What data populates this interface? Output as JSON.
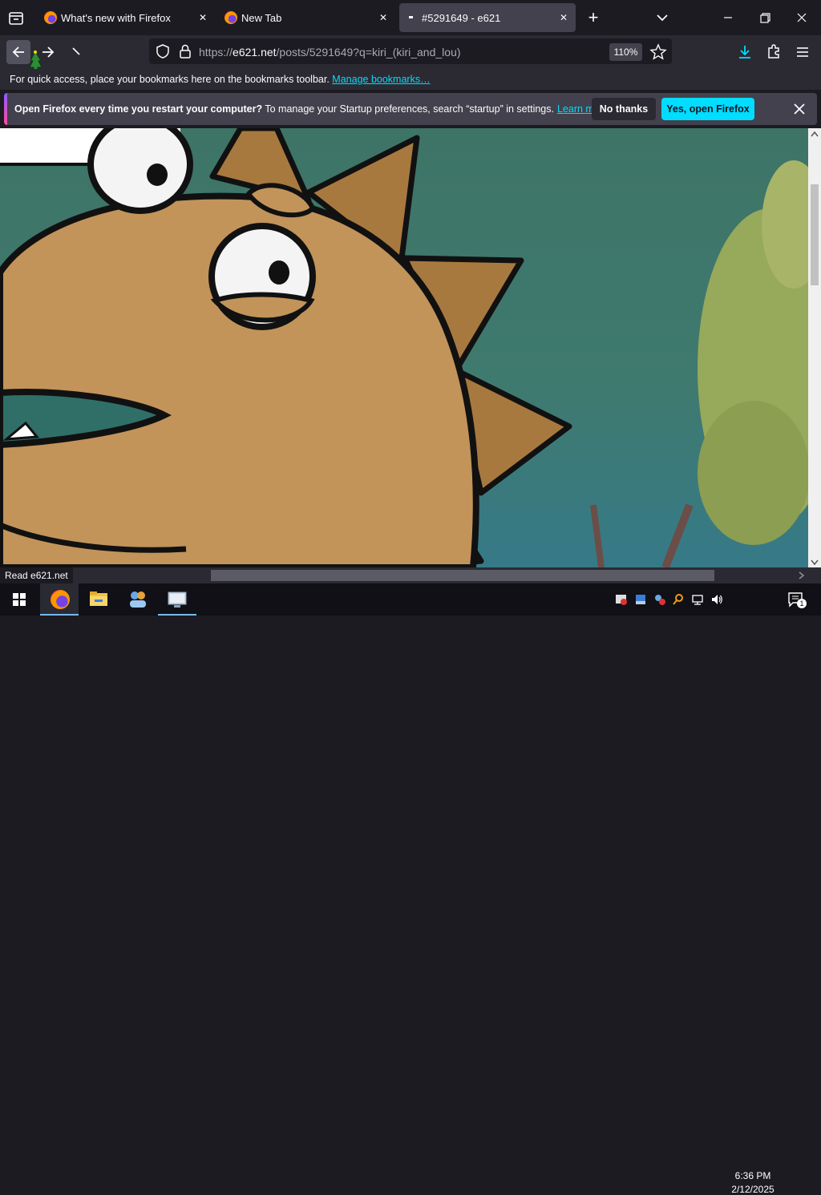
{
  "tabs": [
    {
      "title": "What's new with Firefox",
      "close": "✕"
    },
    {
      "title": "New Tab",
      "close": "✕"
    },
    {
      "title": "#5291649 - e621",
      "close": "✕"
    }
  ],
  "new_tab_glyph": "+",
  "url": {
    "scheme": "https://",
    "host": "e621.net",
    "path": "/posts/5291649?q=kiri_(kiri_and_lou)"
  },
  "zoom": "110%",
  "bookmarks_bar": {
    "message": "For quick access, place your bookmarks here on the bookmarks toolbar.",
    "link": "Manage bookmarks…"
  },
  "notification": {
    "bold": "Open Firefox every time you restart your computer?",
    "text": " To manage your Startup preferences, search “startup” in settings.",
    "link": "Learn more",
    "decline": "No thanks",
    "accept": "Yes, open Firefox"
  },
  "status_text": "Read e621.net",
  "clock": {
    "time": "6:36 PM",
    "date": "2/12/2025"
  },
  "notification_count": "1",
  "colors": {
    "accent": "#00ddff",
    "chrome_dark": "#1c1b22",
    "toolbar": "#2b2a33"
  }
}
